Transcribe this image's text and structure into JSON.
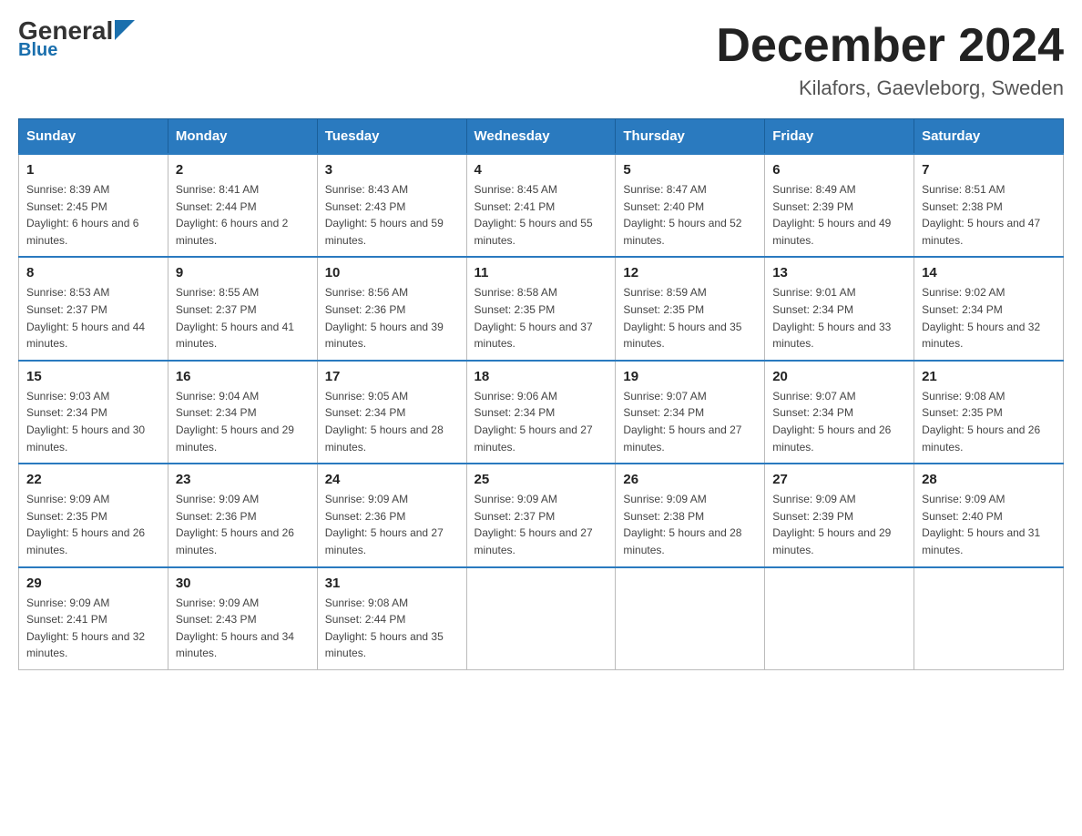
{
  "header": {
    "logo_general": "General",
    "logo_blue": "Blue",
    "month_title": "December 2024",
    "location": "Kilafors, Gaevleborg, Sweden"
  },
  "days_of_week": [
    "Sunday",
    "Monday",
    "Tuesday",
    "Wednesday",
    "Thursday",
    "Friday",
    "Saturday"
  ],
  "weeks": [
    [
      {
        "day": "1",
        "sunrise": "Sunrise: 8:39 AM",
        "sunset": "Sunset: 2:45 PM",
        "daylight": "Daylight: 6 hours and 6 minutes."
      },
      {
        "day": "2",
        "sunrise": "Sunrise: 8:41 AM",
        "sunset": "Sunset: 2:44 PM",
        "daylight": "Daylight: 6 hours and 2 minutes."
      },
      {
        "day": "3",
        "sunrise": "Sunrise: 8:43 AM",
        "sunset": "Sunset: 2:43 PM",
        "daylight": "Daylight: 5 hours and 59 minutes."
      },
      {
        "day": "4",
        "sunrise": "Sunrise: 8:45 AM",
        "sunset": "Sunset: 2:41 PM",
        "daylight": "Daylight: 5 hours and 55 minutes."
      },
      {
        "day": "5",
        "sunrise": "Sunrise: 8:47 AM",
        "sunset": "Sunset: 2:40 PM",
        "daylight": "Daylight: 5 hours and 52 minutes."
      },
      {
        "day": "6",
        "sunrise": "Sunrise: 8:49 AM",
        "sunset": "Sunset: 2:39 PM",
        "daylight": "Daylight: 5 hours and 49 minutes."
      },
      {
        "day": "7",
        "sunrise": "Sunrise: 8:51 AM",
        "sunset": "Sunset: 2:38 PM",
        "daylight": "Daylight: 5 hours and 47 minutes."
      }
    ],
    [
      {
        "day": "8",
        "sunrise": "Sunrise: 8:53 AM",
        "sunset": "Sunset: 2:37 PM",
        "daylight": "Daylight: 5 hours and 44 minutes."
      },
      {
        "day": "9",
        "sunrise": "Sunrise: 8:55 AM",
        "sunset": "Sunset: 2:37 PM",
        "daylight": "Daylight: 5 hours and 41 minutes."
      },
      {
        "day": "10",
        "sunrise": "Sunrise: 8:56 AM",
        "sunset": "Sunset: 2:36 PM",
        "daylight": "Daylight: 5 hours and 39 minutes."
      },
      {
        "day": "11",
        "sunrise": "Sunrise: 8:58 AM",
        "sunset": "Sunset: 2:35 PM",
        "daylight": "Daylight: 5 hours and 37 minutes."
      },
      {
        "day": "12",
        "sunrise": "Sunrise: 8:59 AM",
        "sunset": "Sunset: 2:35 PM",
        "daylight": "Daylight: 5 hours and 35 minutes."
      },
      {
        "day": "13",
        "sunrise": "Sunrise: 9:01 AM",
        "sunset": "Sunset: 2:34 PM",
        "daylight": "Daylight: 5 hours and 33 minutes."
      },
      {
        "day": "14",
        "sunrise": "Sunrise: 9:02 AM",
        "sunset": "Sunset: 2:34 PM",
        "daylight": "Daylight: 5 hours and 32 minutes."
      }
    ],
    [
      {
        "day": "15",
        "sunrise": "Sunrise: 9:03 AM",
        "sunset": "Sunset: 2:34 PM",
        "daylight": "Daylight: 5 hours and 30 minutes."
      },
      {
        "day": "16",
        "sunrise": "Sunrise: 9:04 AM",
        "sunset": "Sunset: 2:34 PM",
        "daylight": "Daylight: 5 hours and 29 minutes."
      },
      {
        "day": "17",
        "sunrise": "Sunrise: 9:05 AM",
        "sunset": "Sunset: 2:34 PM",
        "daylight": "Daylight: 5 hours and 28 minutes."
      },
      {
        "day": "18",
        "sunrise": "Sunrise: 9:06 AM",
        "sunset": "Sunset: 2:34 PM",
        "daylight": "Daylight: 5 hours and 27 minutes."
      },
      {
        "day": "19",
        "sunrise": "Sunrise: 9:07 AM",
        "sunset": "Sunset: 2:34 PM",
        "daylight": "Daylight: 5 hours and 27 minutes."
      },
      {
        "day": "20",
        "sunrise": "Sunrise: 9:07 AM",
        "sunset": "Sunset: 2:34 PM",
        "daylight": "Daylight: 5 hours and 26 minutes."
      },
      {
        "day": "21",
        "sunrise": "Sunrise: 9:08 AM",
        "sunset": "Sunset: 2:35 PM",
        "daylight": "Daylight: 5 hours and 26 minutes."
      }
    ],
    [
      {
        "day": "22",
        "sunrise": "Sunrise: 9:09 AM",
        "sunset": "Sunset: 2:35 PM",
        "daylight": "Daylight: 5 hours and 26 minutes."
      },
      {
        "day": "23",
        "sunrise": "Sunrise: 9:09 AM",
        "sunset": "Sunset: 2:36 PM",
        "daylight": "Daylight: 5 hours and 26 minutes."
      },
      {
        "day": "24",
        "sunrise": "Sunrise: 9:09 AM",
        "sunset": "Sunset: 2:36 PM",
        "daylight": "Daylight: 5 hours and 27 minutes."
      },
      {
        "day": "25",
        "sunrise": "Sunrise: 9:09 AM",
        "sunset": "Sunset: 2:37 PM",
        "daylight": "Daylight: 5 hours and 27 minutes."
      },
      {
        "day": "26",
        "sunrise": "Sunrise: 9:09 AM",
        "sunset": "Sunset: 2:38 PM",
        "daylight": "Daylight: 5 hours and 28 minutes."
      },
      {
        "day": "27",
        "sunrise": "Sunrise: 9:09 AM",
        "sunset": "Sunset: 2:39 PM",
        "daylight": "Daylight: 5 hours and 29 minutes."
      },
      {
        "day": "28",
        "sunrise": "Sunrise: 9:09 AM",
        "sunset": "Sunset: 2:40 PM",
        "daylight": "Daylight: 5 hours and 31 minutes."
      }
    ],
    [
      {
        "day": "29",
        "sunrise": "Sunrise: 9:09 AM",
        "sunset": "Sunset: 2:41 PM",
        "daylight": "Daylight: 5 hours and 32 minutes."
      },
      {
        "day": "30",
        "sunrise": "Sunrise: 9:09 AM",
        "sunset": "Sunset: 2:43 PM",
        "daylight": "Daylight: 5 hours and 34 minutes."
      },
      {
        "day": "31",
        "sunrise": "Sunrise: 9:08 AM",
        "sunset": "Sunset: 2:44 PM",
        "daylight": "Daylight: 5 hours and 35 minutes."
      },
      null,
      null,
      null,
      null
    ]
  ]
}
